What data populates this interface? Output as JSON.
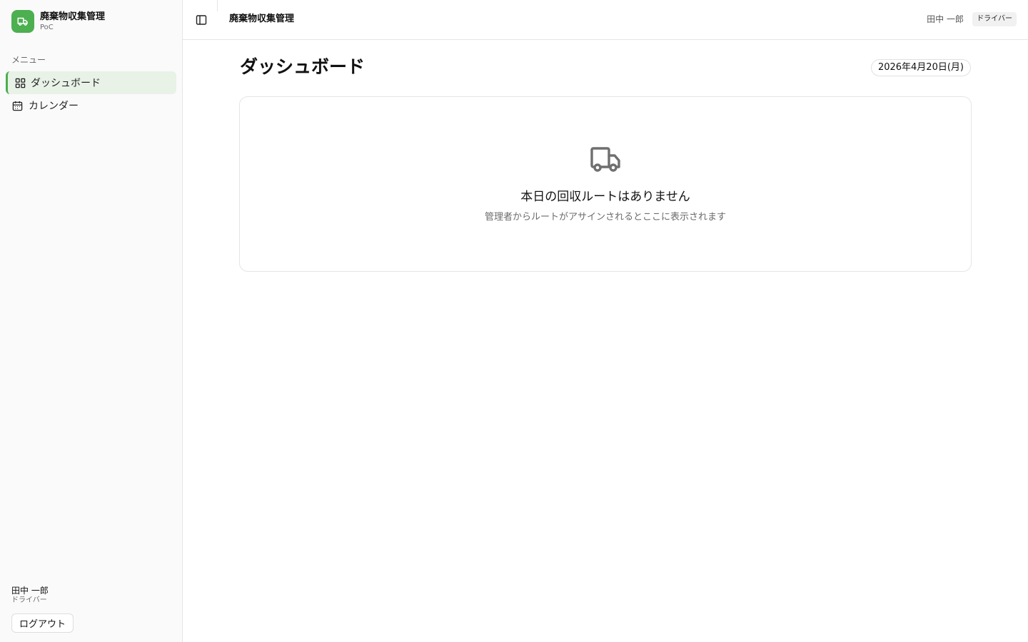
{
  "app": {
    "title": "廃棄物収集管理",
    "subtitle": "PoC",
    "accent_color": "#4caf50"
  },
  "sidebar": {
    "menu_label": "メニュー",
    "items": [
      {
        "label": "ダッシュボード",
        "icon": "grid-icon",
        "active": true
      },
      {
        "label": "カレンダー",
        "icon": "calendar-icon",
        "active": false
      }
    ],
    "user": {
      "name": "田中 一郎",
      "role": "ドライバー"
    },
    "logout_label": "ログアウト"
  },
  "topbar": {
    "title": "廃棄物収集管理",
    "user_name": "田中 一郎",
    "role_badge": "ドライバー"
  },
  "main": {
    "page_title": "ダッシュボード",
    "date": "2026年4月20日(月)",
    "empty_state": {
      "icon": "truck-icon",
      "title": "本日の回収ルートはありません",
      "subtitle": "管理者からルートがアサインされるとここに表示されます"
    }
  }
}
